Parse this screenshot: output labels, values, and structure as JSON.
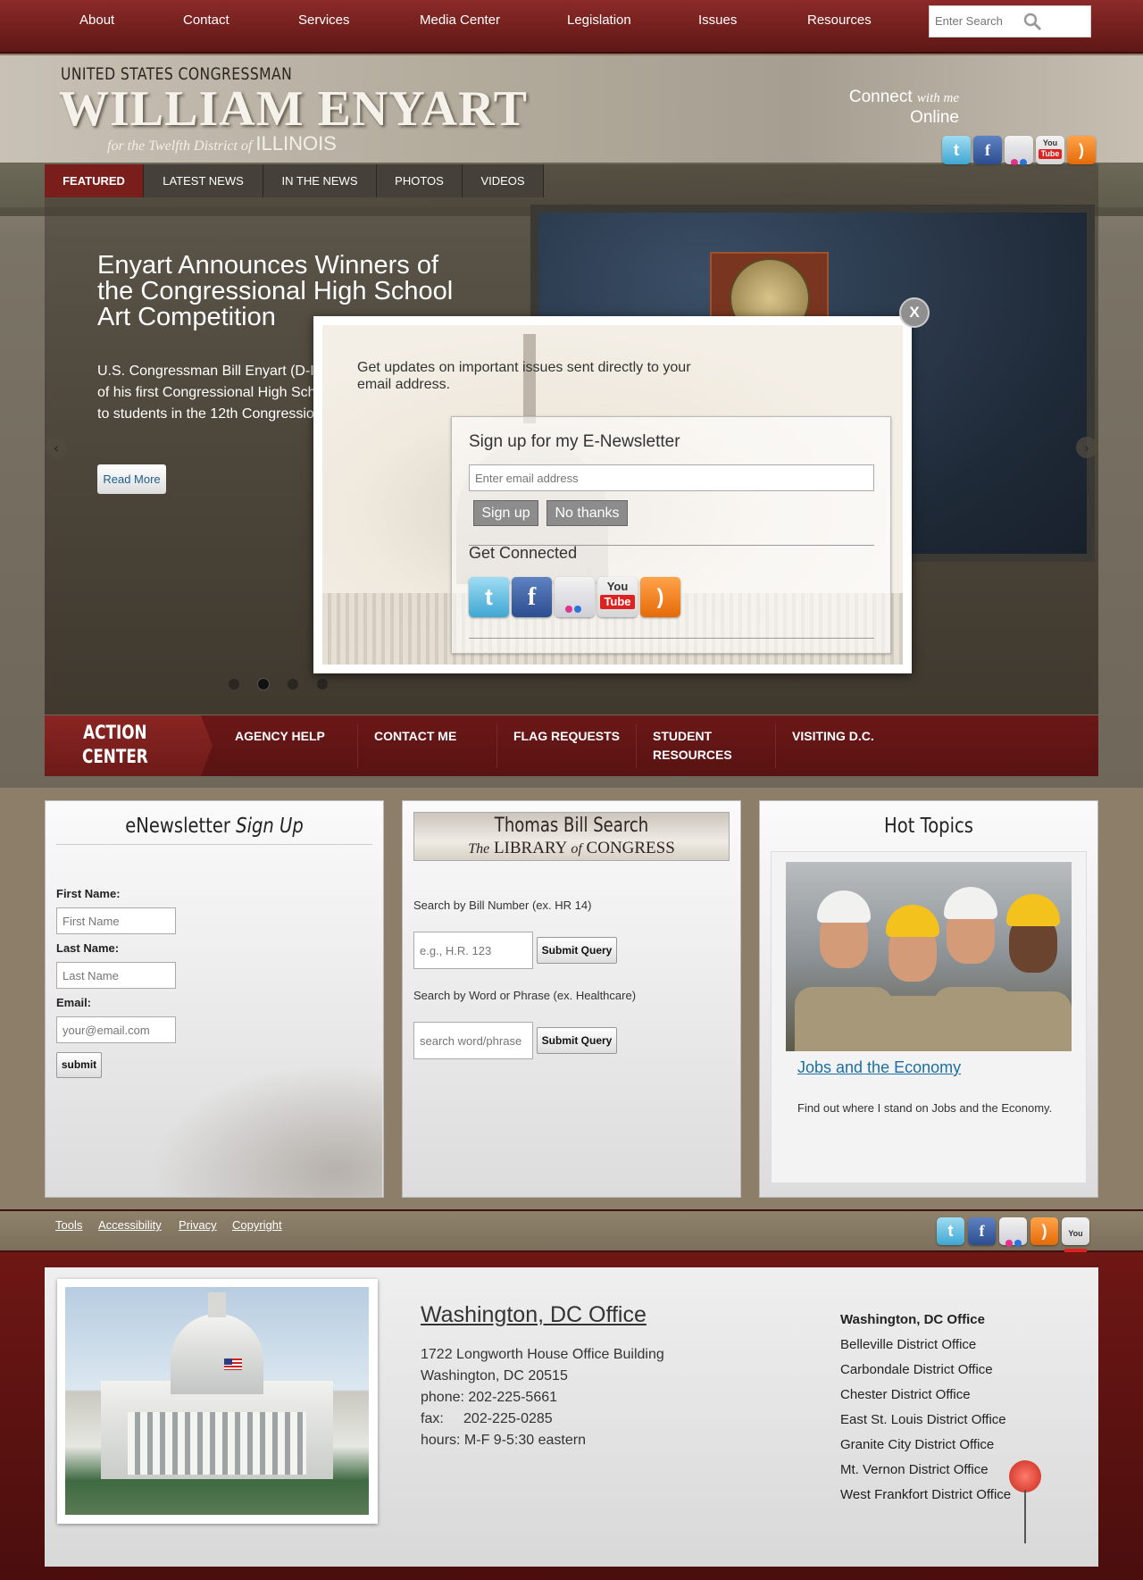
{
  "topnav": {
    "items": [
      "About",
      "Contact",
      "Services",
      "Media Center",
      "Legislation",
      "Issues",
      "Resources"
    ],
    "search_placeholder": "Enter Search"
  },
  "header": {
    "title_top": "UNITED STATES CONGRESSMAN",
    "title_main": "WILLIAM ENYART",
    "title_sub_pre": "for the Twelfth District of",
    "title_sub_state": "ILLINOIS",
    "connect_line1": "Connect",
    "connect_with": "with me",
    "connect_line2": "Online",
    "social": [
      "twitter-icon",
      "facebook-icon",
      "flickr-icon",
      "youtube-icon",
      "rss-icon"
    ]
  },
  "featured": {
    "tabs": [
      "FEATURED",
      "LATEST NEWS",
      "IN THE NEWS",
      "PHOTOS",
      "VIDEOS"
    ],
    "active_tab": 0,
    "slide_title": "Enyart Announces Winners of the Congressional High School Art Competition",
    "slide_line1": "U.S. Congressman Bill Enyart (D-I",
    "slide_line2": "of his first Congressional High Sch",
    "slide_line3": "to students in the 12th Congressio",
    "read_more": "Read More",
    "slide_count": 4,
    "active_slide": 1
  },
  "modal": {
    "close": "X",
    "intro": "Get updates on important issues sent directly to your email address.",
    "heading": "Sign up for my E-Newsletter",
    "email_placeholder": "Enter email address",
    "signup": "Sign up",
    "no_thanks": "No thanks",
    "connected": "Get Connected"
  },
  "action": {
    "label_line1": "ACTION",
    "label_line2": "CENTER",
    "items": [
      "AGENCY HELP",
      "CONTACT ME",
      "FLAG REQUESTS",
      "STUDENT RESOURCES",
      "VISITING D.C."
    ]
  },
  "newsletter": {
    "title": "eNewsletter",
    "title_em": "Sign Up",
    "first_label": "First Name:",
    "first_placeholder": "First Name",
    "last_label": "Last Name:",
    "last_placeholder": "Last Name",
    "email_label": "Email:",
    "email_placeholder": "your@email.com",
    "submit": "submit"
  },
  "thomas": {
    "banner_title": "Thomas Bill Search",
    "banner_sub_the": "The",
    "banner_sub": "LIBRARY",
    "banner_of": "of",
    "banner_congress": "CONGRESS",
    "bill_label": "Search by Bill Number (ex. HR 14)",
    "bill_placeholder": "e.g., H.R. 123",
    "phrase_label": "Search by Word or Phrase (ex. Healthcare)",
    "phrase_placeholder": "search word/phrase",
    "submit": "Submit Query"
  },
  "hot": {
    "title": "Hot Topics",
    "link": "Jobs and the Economy",
    "desc": "Find out where I stand on Jobs and the Economy."
  },
  "footer_links": [
    "Tools",
    "Accessibility",
    "Privacy",
    "Copyright"
  ],
  "footer": {
    "dc_title": "Washington, DC Office",
    "address1": "1722 Longworth House Office Building",
    "address2": "Washington, DC 20515",
    "phone": "phone: 202-225-5661",
    "fax": "fax:     202-225-0285",
    "hours": "hours: M-F 9-5:30 eastern",
    "offices": [
      "Washington, DC Office",
      "Belleville District Office",
      "Carbondale District Office",
      "Chester District Office",
      "East St. Louis District Office",
      "Granite City District Office",
      "Mt. Vernon District Office",
      "West Frankfort District Office"
    ]
  },
  "colors": {
    "brand_red": "#6b1817",
    "link_blue": "#1c6ea4"
  }
}
